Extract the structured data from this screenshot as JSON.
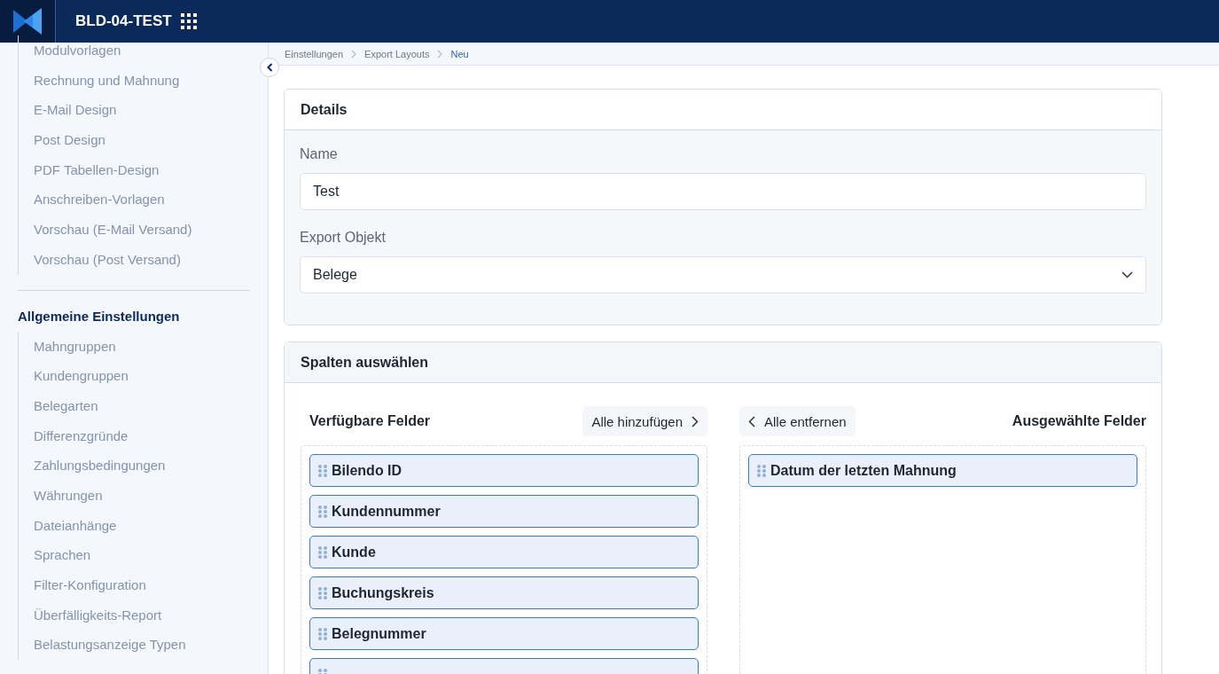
{
  "header": {
    "title": "BLD-04-TEST"
  },
  "sidebar": {
    "items_top": [
      "Modulvorlagen",
      "Rechnung und Mahnung",
      "E-Mail Design",
      "Post Design",
      "PDF Tabellen-Design",
      "Anschreiben-Vorlagen",
      "Vorschau (E-Mail Versand)",
      "Vorschau (Post Versand)"
    ],
    "section_title": "Allgemeine Einstellungen",
    "items": [
      "Mahngruppen",
      "Kundengruppen",
      "Belegarten",
      "Differenzgründe",
      "Zahlungsbedingungen",
      "Währungen",
      "Dateianhänge",
      "Sprachen",
      "Filter-Konfiguration",
      "Überfälligkeits-Report",
      "Belastungsanzeige Typen"
    ]
  },
  "breadcrumb": [
    {
      "label": "Einstellungen",
      "current": false
    },
    {
      "label": "Export Layouts",
      "current": false
    },
    {
      "label": "Neu",
      "current": true
    }
  ],
  "details": {
    "title": "Details",
    "name_label": "Name",
    "name_value": "Test",
    "object_label": "Export Objekt",
    "object_value": "Belege"
  },
  "columns": {
    "title": "Spalten auswählen",
    "available_title": "Verfügbare Felder",
    "add_all": "Alle hinzufügen",
    "remove_all": "Alle entfernen",
    "selected_title": "Ausgewählte Felder",
    "available": [
      "Bilendo ID",
      "Kundennummer",
      "Kunde",
      "Buchungskreis",
      "Belegnummer"
    ],
    "available_more_below": true,
    "selected": [
      "Datum der letzten Mahnung"
    ]
  }
}
